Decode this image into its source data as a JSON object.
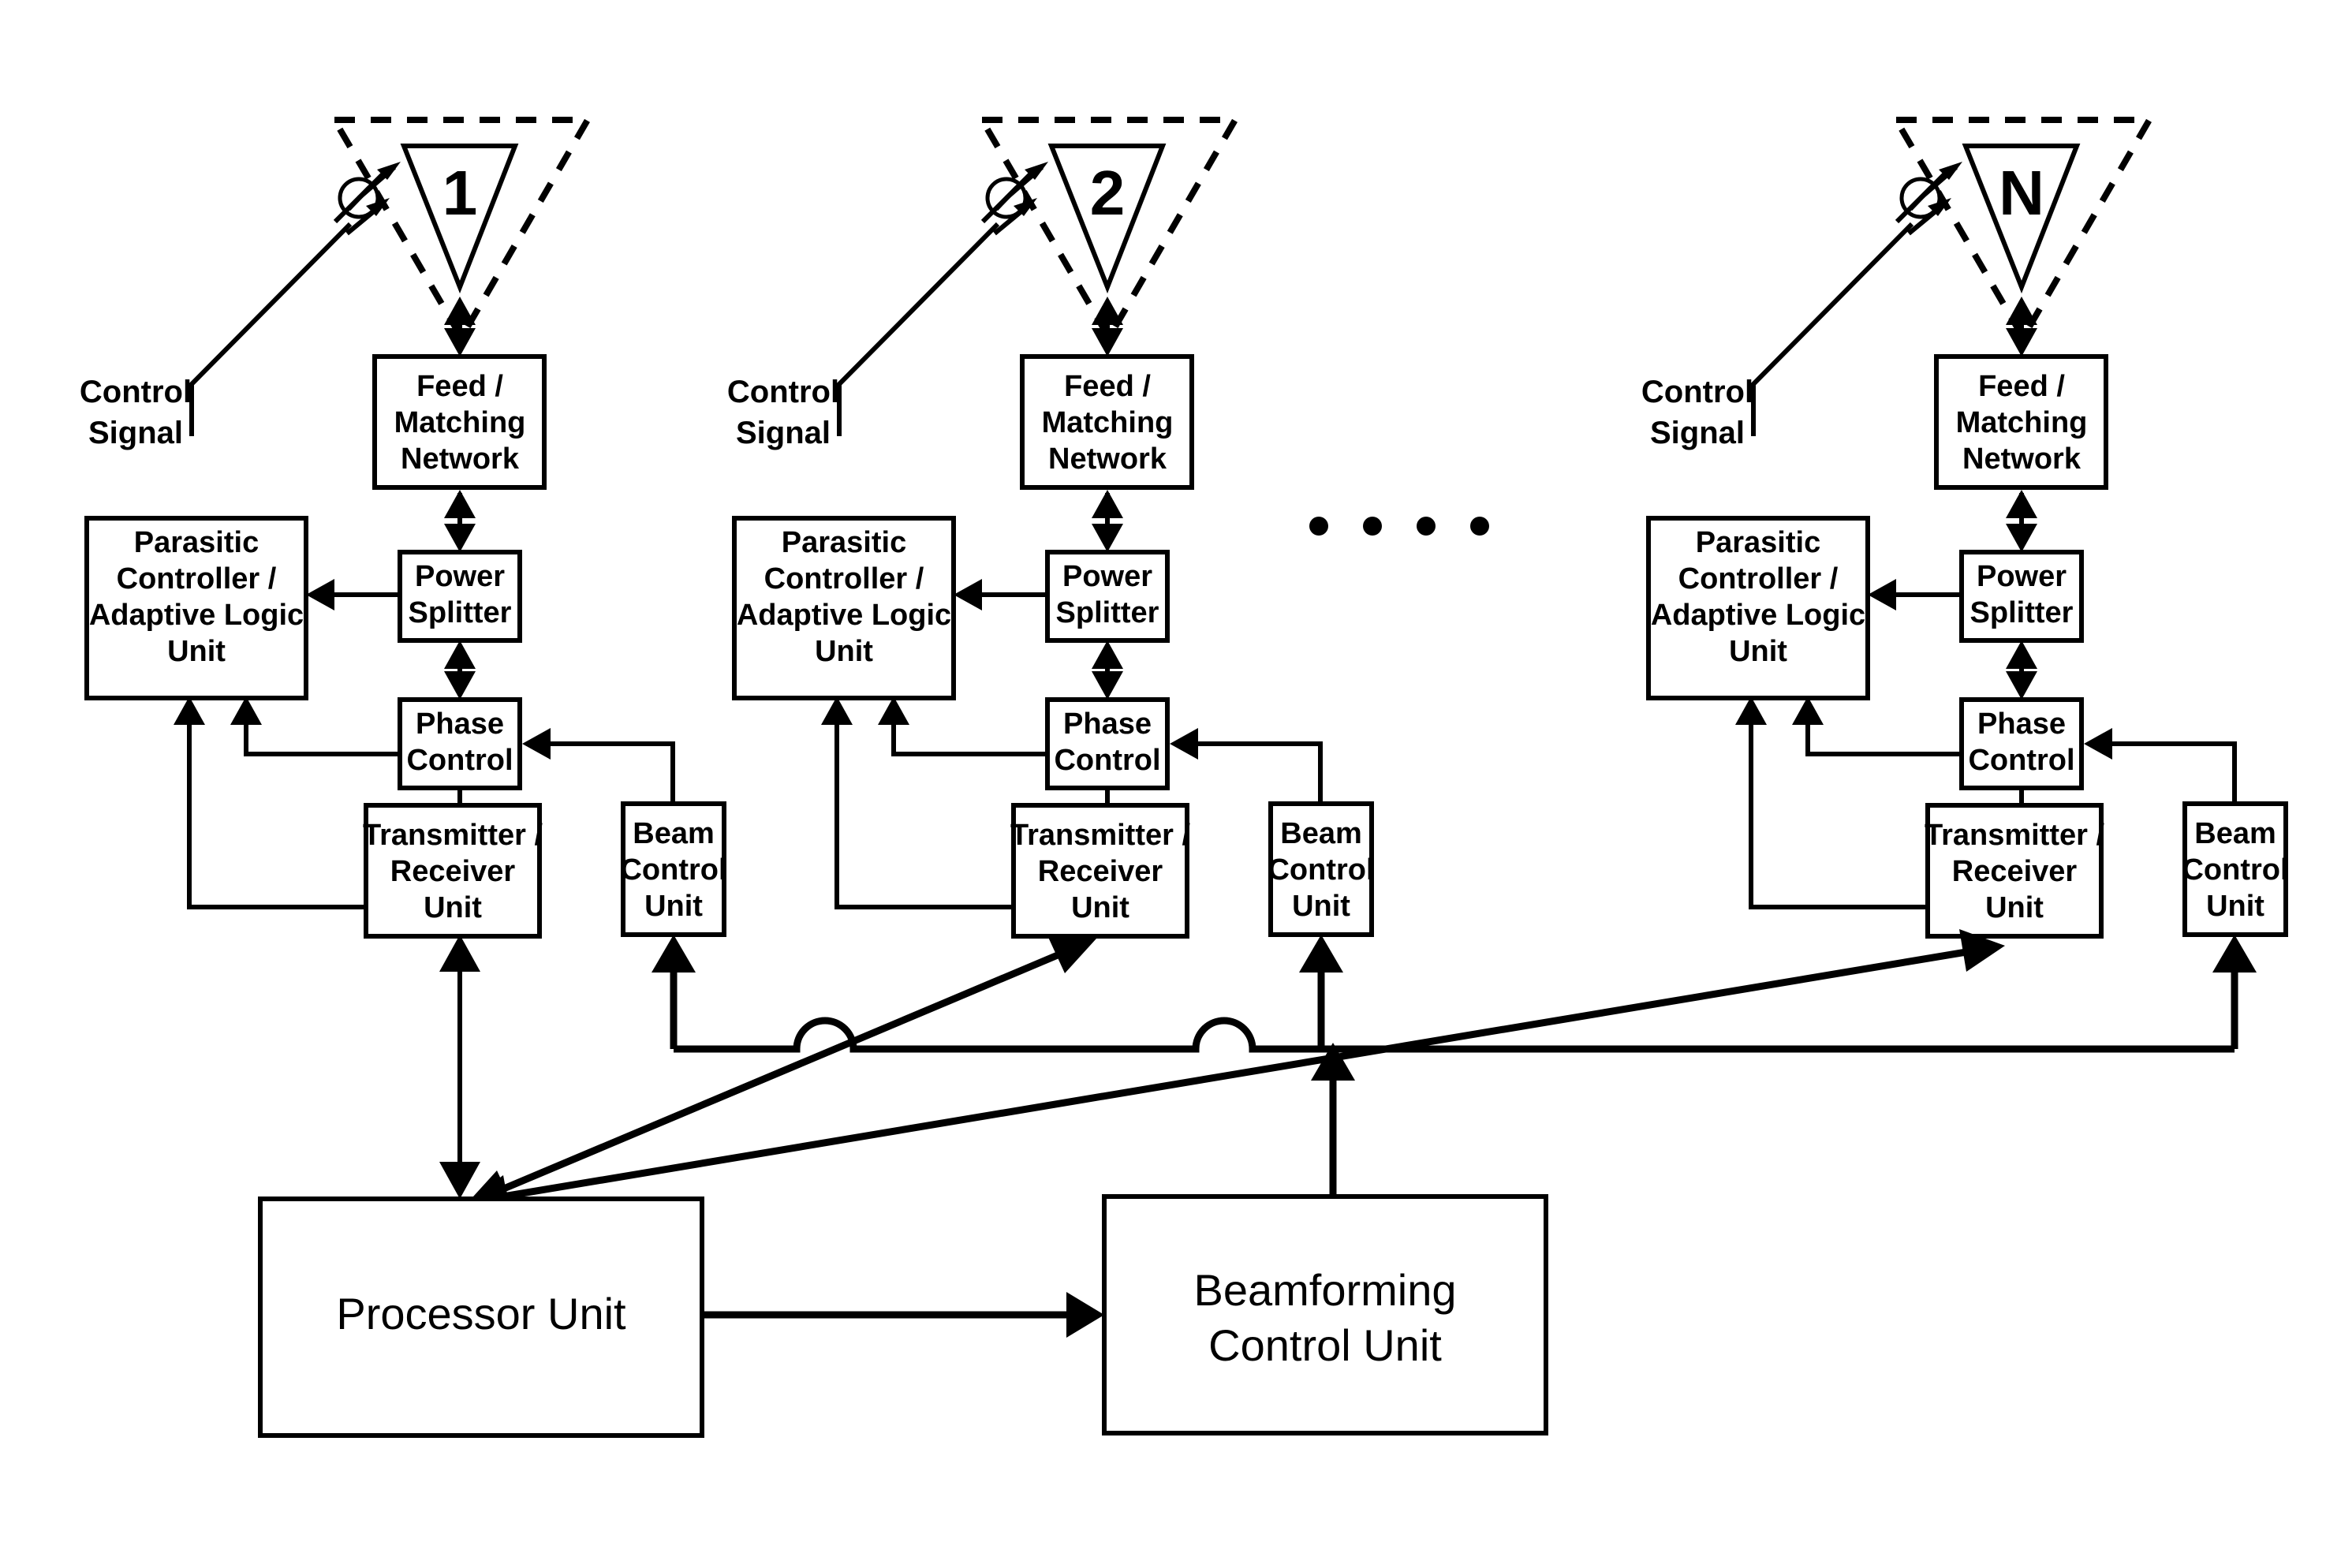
{
  "diagram": {
    "title": "Adaptive Parasitic Phased Array Antenna System",
    "type": "block-diagram",
    "stroke_color": "#000000",
    "background_color": "#ffffff"
  },
  "elements": [
    {
      "id": "element-1",
      "antenna_number": "1",
      "control_signal_label_line1": "Control",
      "control_signal_label_line2": "Signal",
      "feed_line1": "Feed /",
      "feed_line2": "Matching",
      "feed_line3": "Network",
      "parasitic_line1": "Parasitic",
      "parasitic_line2": "Controller /",
      "parasitic_line3": "Adaptive Logic",
      "parasitic_line4": "Unit",
      "power_line1": "Power",
      "power_line2": "Splitter",
      "phase_line1": "Phase",
      "phase_line2": "Control",
      "txrx_line1": "Transmitter /",
      "txrx_line2": "Receiver",
      "txrx_line3": "Unit",
      "beam_line1": "Beam",
      "beam_line2": "Control",
      "beam_line3": "Unit"
    },
    {
      "id": "element-2",
      "antenna_number": "2",
      "control_signal_label_line1": "Control",
      "control_signal_label_line2": "Signal",
      "feed_line1": "Feed /",
      "feed_line2": "Matching",
      "feed_line3": "Network",
      "parasitic_line1": "Parasitic",
      "parasitic_line2": "Controller /",
      "parasitic_line3": "Adaptive Logic",
      "parasitic_line4": "Unit",
      "power_line1": "Power",
      "power_line2": "Splitter",
      "phase_line1": "Phase",
      "phase_line2": "Control",
      "txrx_line1": "Transmitter /",
      "txrx_line2": "Receiver",
      "txrx_line3": "Unit",
      "beam_line1": "Beam",
      "beam_line2": "Control",
      "beam_line3": "Unit"
    },
    {
      "id": "element-n",
      "antenna_number": "N",
      "control_signal_label_line1": "Control",
      "control_signal_label_line2": "Signal",
      "feed_line1": "Feed /",
      "feed_line2": "Matching",
      "feed_line3": "Network",
      "parasitic_line1": "Parasitic",
      "parasitic_line2": "Controller /",
      "parasitic_line3": "Adaptive Logic",
      "parasitic_line4": "Unit",
      "power_line1": "Power",
      "power_line2": "Splitter",
      "phase_line1": "Phase",
      "phase_line2": "Control",
      "txrx_line1": "Transmitter /",
      "txrx_line2": "Receiver",
      "txrx_line3": "Unit",
      "beam_line1": "Beam",
      "beam_line2": "Control",
      "beam_line3": "Unit"
    }
  ],
  "ellipsis": {
    "dot_count": 4,
    "meaning": "repeated elements"
  },
  "bottom": {
    "processor_label": "Processor Unit",
    "beamforming_line1": "Beamforming",
    "beamforming_line2": "Control Unit"
  }
}
